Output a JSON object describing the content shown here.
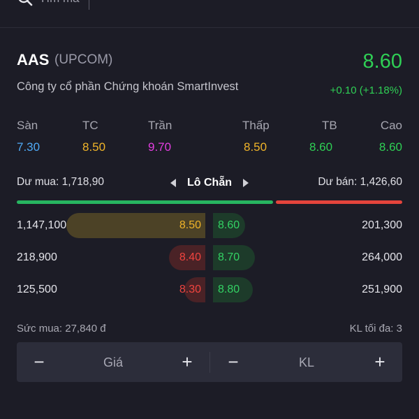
{
  "search": {
    "placeholder": "Tìm mã"
  },
  "header": {
    "symbol": "AAS",
    "exchange": "(UPCOM)",
    "price": "8.60",
    "company": "Công ty cổ phần Chứng khoán SmartInvest",
    "change": "+0.10  (+1.18%)"
  },
  "stats": [
    {
      "label": "Sàn",
      "value": "7.30",
      "color": "#4fa9f5"
    },
    {
      "label": "TC",
      "value": "8.50",
      "color": "#f0b429"
    },
    {
      "label": "Trần",
      "value": "9.70",
      "color": "#e33ee0"
    },
    {
      "label": "Thấp",
      "value": "8.50",
      "color": "#f0b429"
    },
    {
      "label": "TB",
      "value": "8.60",
      "color": "#2fcf55"
    },
    {
      "label": "Cao",
      "value": "8.60",
      "color": "#2fcf55"
    }
  ],
  "orderbook": {
    "buy_label": "Dư mua: 1,718,90",
    "sell_label": "Dư bán: 1,426,60",
    "lot_label": "Lô Chẵn",
    "buy_share": 0.67,
    "rows": [
      {
        "bid_volume": "1,147,100",
        "bid_price": "8.50",
        "bid_color": "#f0b429",
        "bid_fill": 0.72,
        "ask_price": "8.60",
        "ask_volume": "201,300",
        "ask_fill": 0.17
      },
      {
        "bid_volume": "218,900",
        "bid_price": "8.40",
        "bid_color": "#f1443f",
        "bid_fill": 0.19,
        "ask_price": "8.70",
        "ask_volume": "264,000",
        "ask_fill": 0.22
      },
      {
        "bid_volume": "125,500",
        "bid_price": "8.30",
        "bid_color": "#f1443f",
        "bid_fill": 0.11,
        "ask_price": "8.80",
        "ask_volume": "251,900",
        "ask_fill": 0.21
      }
    ]
  },
  "order": {
    "buying_power": "Sức mua: 27,840 đ",
    "max_volume": "KL tối đa: 3",
    "price_label": "Giá",
    "volume_label": "KL",
    "minus": "−",
    "plus": "+"
  }
}
